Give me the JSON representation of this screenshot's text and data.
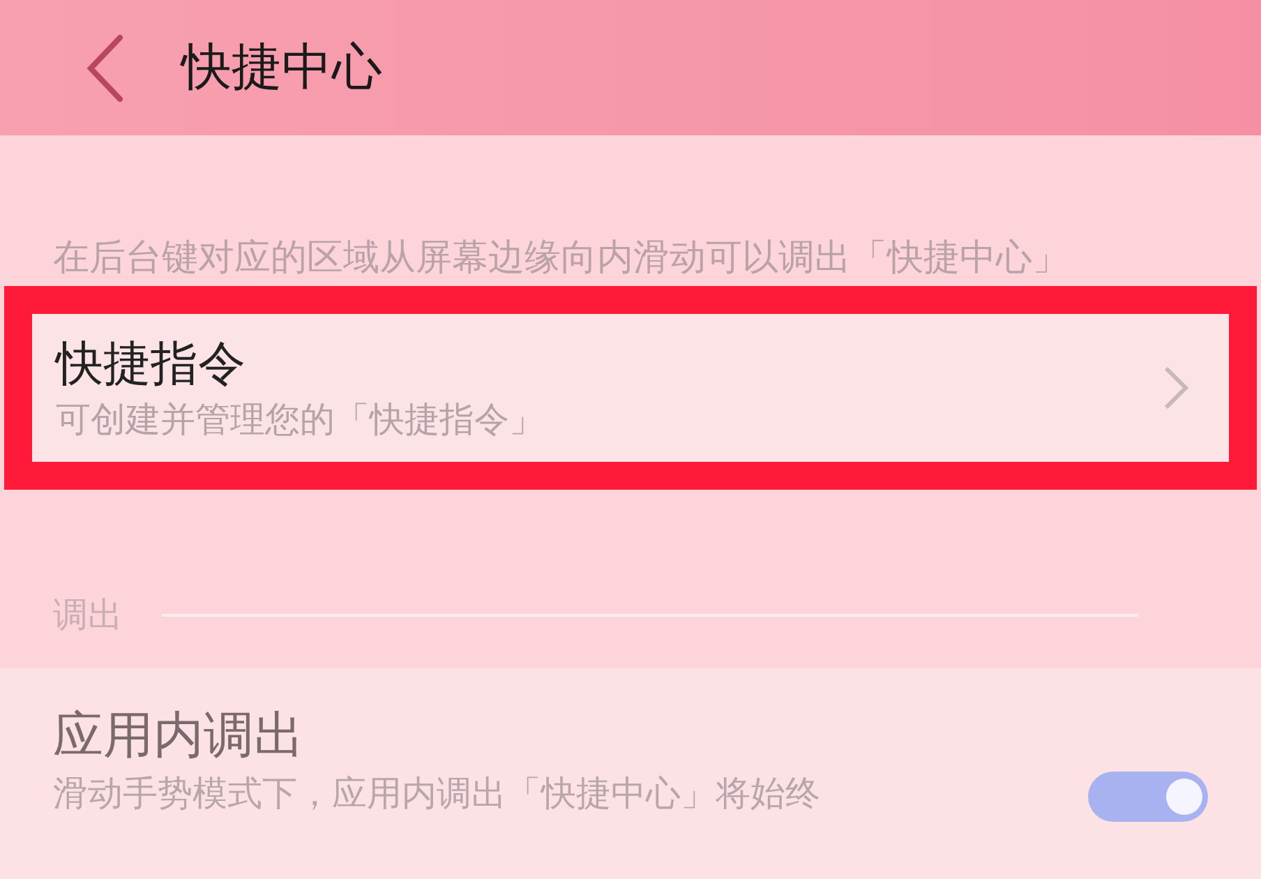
{
  "header": {
    "title": "快捷中心"
  },
  "description": "在后台键对应的区域从屏幕边缘向内滑动可以调出「快捷中心」",
  "shortcut_item": {
    "title": "快捷指令",
    "subtitle": "可创建并管理您的「快捷指令」",
    "highlighted": true
  },
  "section": {
    "title": "调出"
  },
  "setting_item": {
    "title": "应用内调出",
    "subtitle": "滑动手势模式下，应用内调出「快捷中心」将始终",
    "on": true
  }
}
